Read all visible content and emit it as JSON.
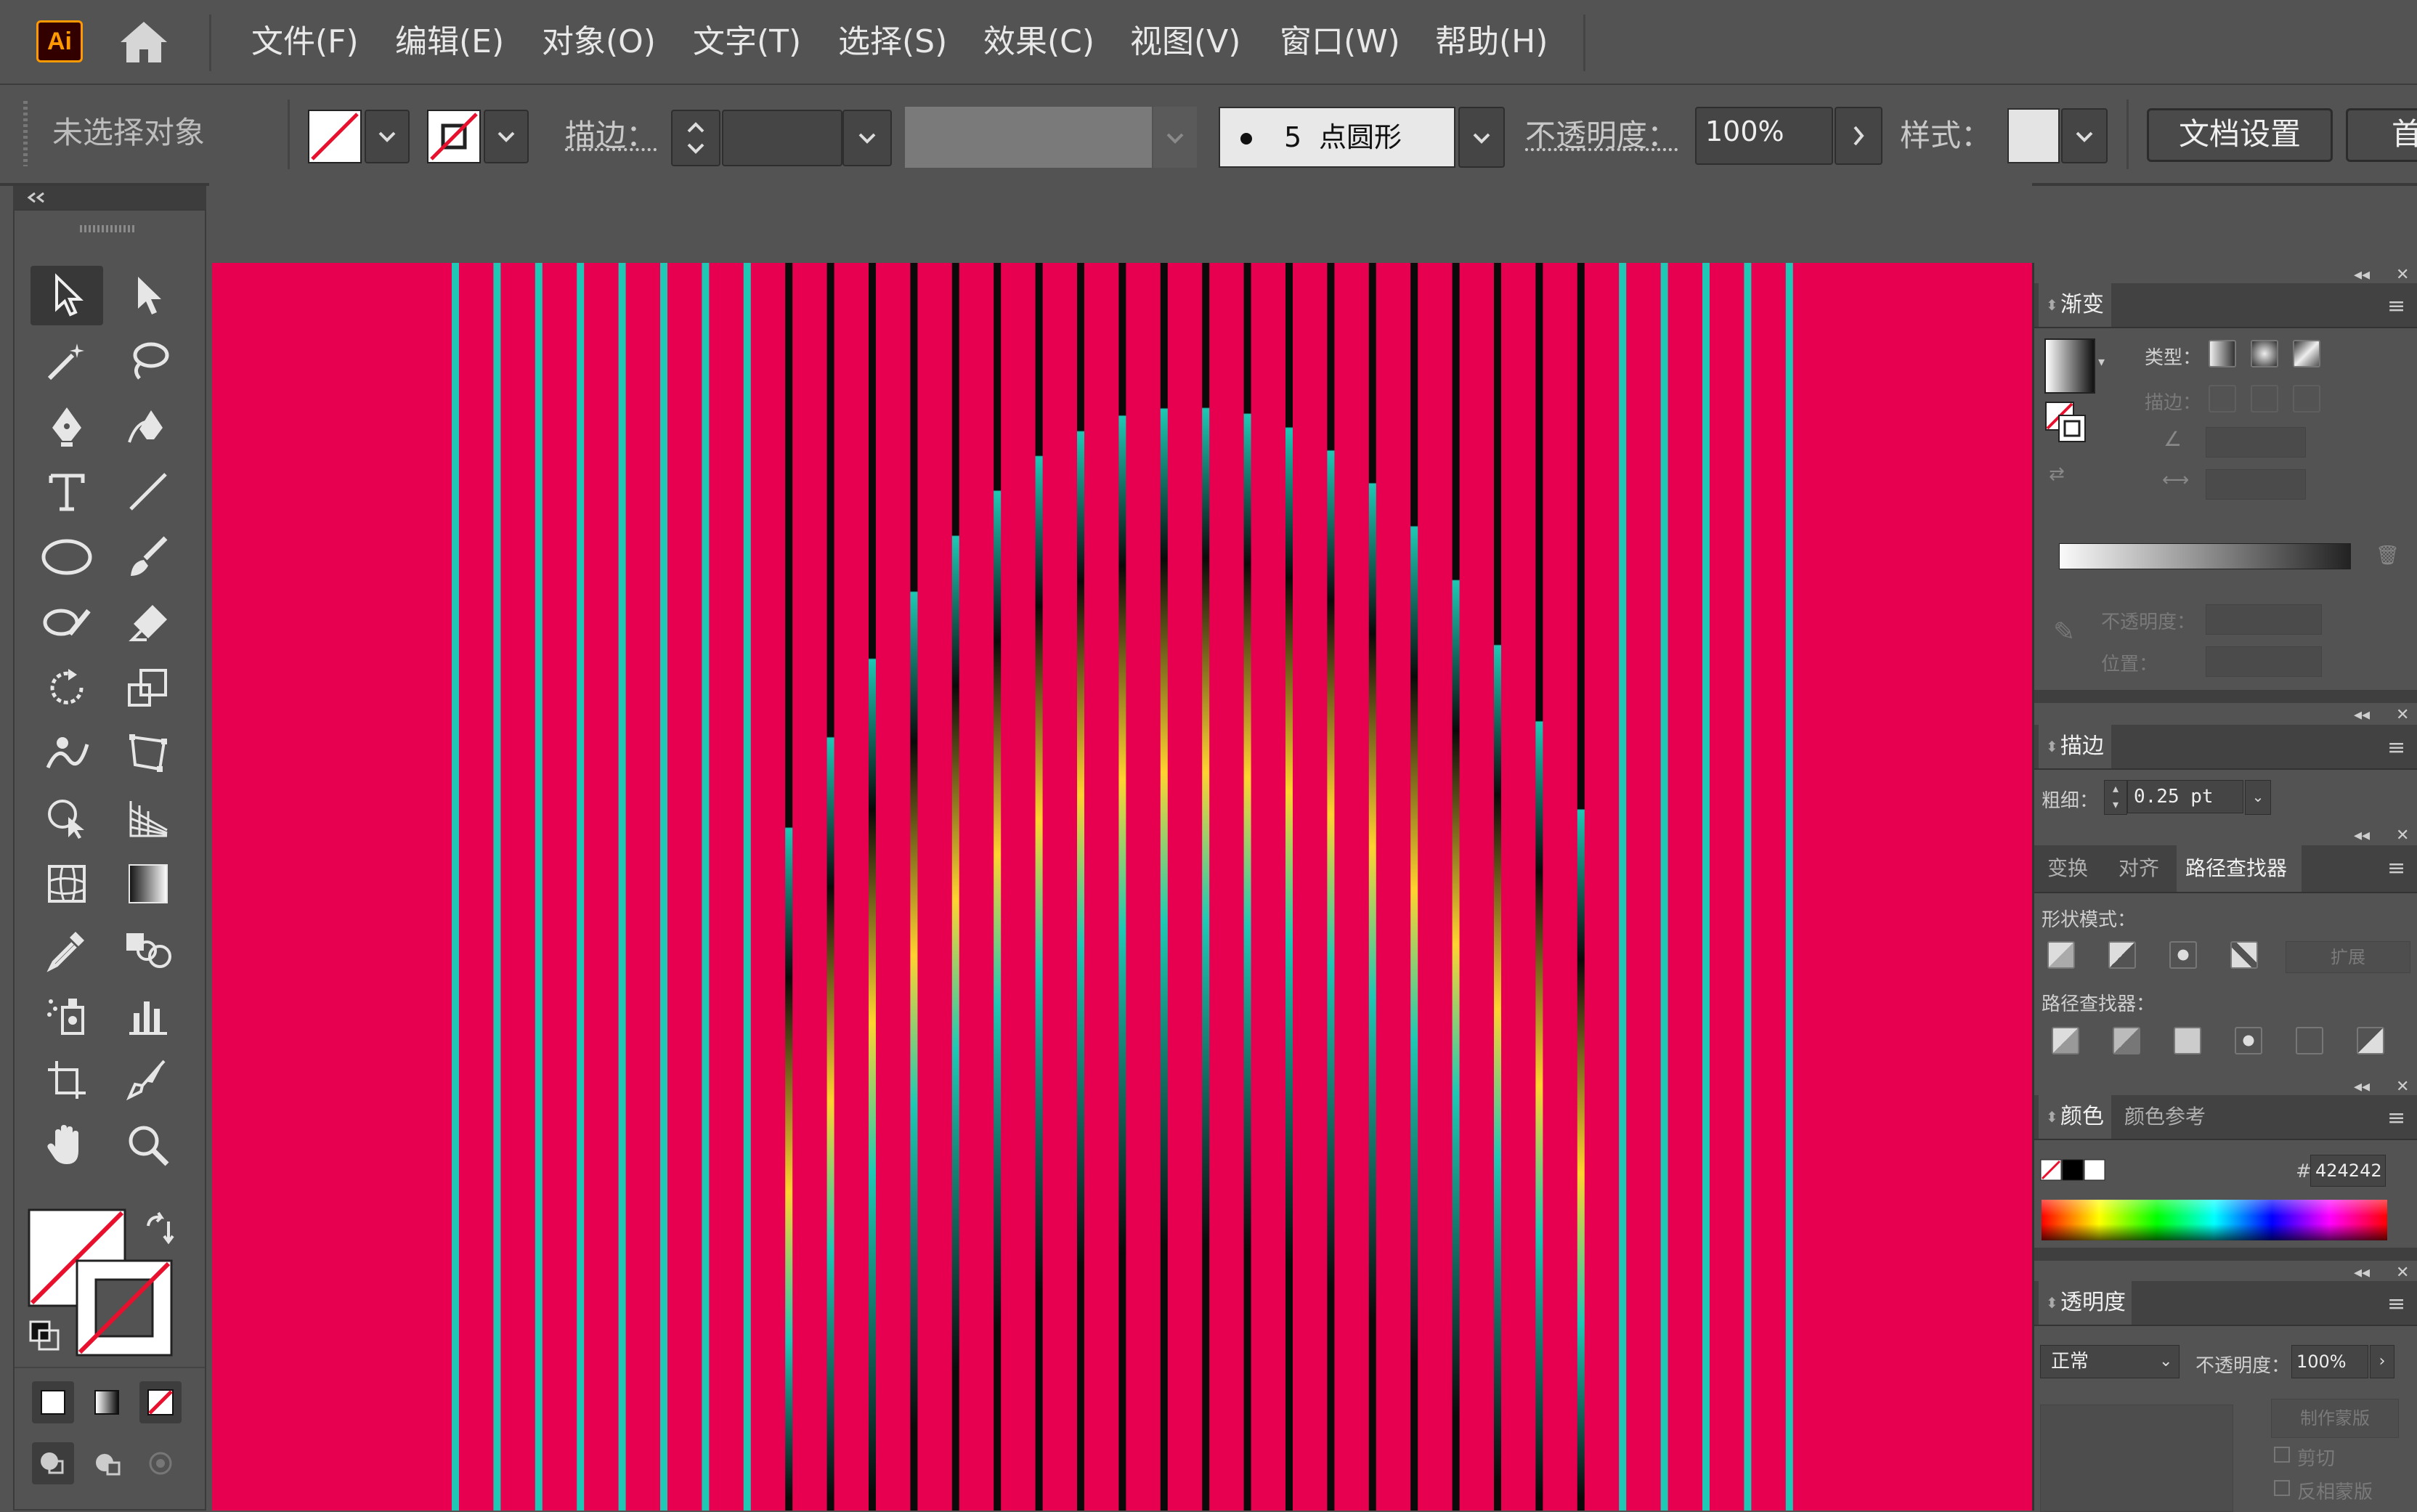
{
  "app": {
    "logo_text": "Ai",
    "accent": "#ff9a00",
    "artboard_color": "#e6004f"
  },
  "menu": {
    "items": [
      "文件(F)",
      "编辑(E)",
      "对象(O)",
      "文字(T)",
      "选择(S)",
      "效果(C)",
      "视图(V)",
      "窗口(W)",
      "帮助(H)"
    ]
  },
  "controlbar": {
    "selection_status": "未选择对象",
    "stroke_label": "描边：",
    "brush_size": "5",
    "brush_name": "点圆形",
    "opacity_label": "不透明度：",
    "opacity_value": "100%",
    "style_label": "样式：",
    "doc_setup_button": "文档设置",
    "prefs_button": "首"
  },
  "panels": {
    "gradient": {
      "title": "渐变",
      "type_label": "类型：",
      "stroke_label": "描边：",
      "opacity_label": "不透明度：",
      "location_label": "位置："
    },
    "stroke": {
      "title": "描边",
      "weight_label": "粗细：",
      "weight_value": "0.25 pt"
    },
    "pathfinder_group": {
      "tabs": [
        "变换",
        "对齐",
        "路径查找器"
      ],
      "active_tab": "路径查找器",
      "shape_modes_label": "形状模式：",
      "expand_button": "扩展",
      "pathfinders_label": "路径查找器："
    },
    "color": {
      "tabs": [
        "颜色",
        "颜色参考"
      ],
      "hex_prefix": "#",
      "hex_value": "424242"
    },
    "transparency": {
      "title": "透明度",
      "blend_mode": "正常",
      "opacity_label": "不透明度：",
      "opacity_value": "100%",
      "make_mask_button": "制作蒙版",
      "clip_label": "剪切",
      "invert_mask_label": "反相蒙版"
    }
  },
  "artwork": {
    "stripe_colors": {
      "background": "#e6004f",
      "dark": "#0a0a0a",
      "teal": "#1ec8b4",
      "gold": "#ffd230"
    }
  }
}
